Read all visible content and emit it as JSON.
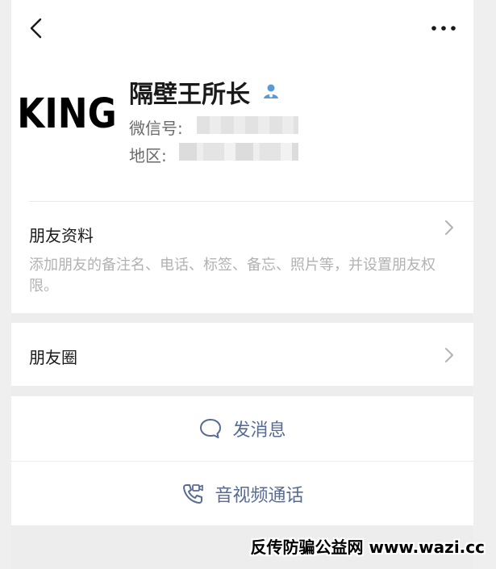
{
  "header": {
    "back_icon": "chevron-left-icon",
    "more_icon": "more-horizontal-icon"
  },
  "profile": {
    "avatar_text": "KING",
    "name": "隔壁王所长",
    "verify_icon": "person-badge-icon",
    "wechat_id_label": "微信号:",
    "region_label": "地区:"
  },
  "friend_info": {
    "title": "朋友资料",
    "description": "添加朋友的备注名、电话、标签、备忘、照片等，并设置朋友权限。"
  },
  "moments": {
    "title": "朋友圈"
  },
  "actions": {
    "message_label": "发消息",
    "call_label": "音视频通话"
  },
  "watermark": "反传防骗公益网 www.wazi.cc",
  "colors": {
    "link_blue": "#576b95",
    "background": "#ededed"
  }
}
